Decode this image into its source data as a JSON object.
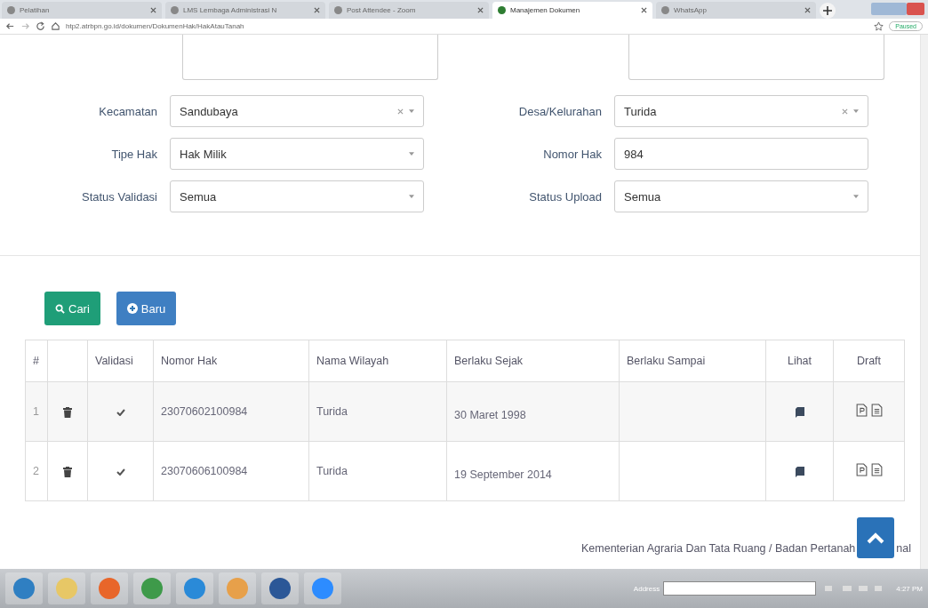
{
  "browser": {
    "tabs": [
      {
        "title": "Pelatihan",
        "selected": false
      },
      {
        "title": "LMS Lembaga Administrasi N",
        "selected": false
      },
      {
        "title": "Post Attendee - Zoom",
        "selected": false
      },
      {
        "title": "Manajemen Dokumen",
        "selected": true
      },
      {
        "title": "WhatsApp",
        "selected": false
      }
    ],
    "url": "htp2.atrbpn.go.id/dokumen/DokumenHak/HakAtauTanah",
    "profile": "Paused"
  },
  "filters": [
    {
      "label": "Kecamatan",
      "value": "Sandubaya",
      "kind": "select",
      "clearable": true
    },
    {
      "label": "Desa/Kelurahan",
      "value": "Turida",
      "kind": "select",
      "clearable": true
    },
    {
      "label": "Tipe Hak",
      "value": "Hak Milik",
      "kind": "select",
      "clearable": false
    },
    {
      "label": "Nomor Hak",
      "value": "984",
      "kind": "text",
      "clearable": false
    },
    {
      "label": "Status Validasi",
      "value": "Semua",
      "kind": "select",
      "clearable": false
    },
    {
      "label": "Status Upload",
      "value": "Semua",
      "kind": "select",
      "clearable": false
    }
  ],
  "buttons": [
    {
      "label": "Cari",
      "kind": "search"
    },
    {
      "label": "Baru",
      "kind": "new"
    }
  ],
  "table": {
    "columns": [
      "#",
      "Validasi",
      "Nomor Hak",
      "Nama Wilayah",
      "Berlaku Sejak",
      "Berlaku Sampai",
      "Lihat",
      "Draft"
    ],
    "rows": [
      {
        "no": "1",
        "validated": true,
        "nomor_hak": "23070602100984",
        "nama_wilayah": "Turida",
        "berlaku_sejak": "30 Maret 1998"
      },
      {
        "no": "2",
        "validated": true,
        "nomor_hak": "23070606100984",
        "nama_wilayah": "Turida",
        "berlaku_sejak": "19 September 2014"
      }
    ]
  },
  "footer": {
    "text_before": "Kementerian Agraria Dan Tata Ruang / Badan Pertanah",
    "text_after": "nal"
  },
  "taskbar": {
    "address_label": "Address",
    "time": "4:27 PM"
  }
}
